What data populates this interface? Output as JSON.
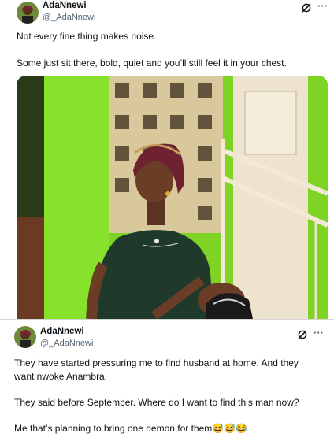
{
  "tweets": [
    {
      "author": {
        "name": "AdaNnewi",
        "handle": "@_AdaNnewi"
      },
      "text": [
        "Not every fine thing makes noise.",
        "Some just sit there, bold, quiet and you’ll still feel it in your chest."
      ],
      "icons": [
        "grok-icon",
        "more-icon"
      ]
    },
    {
      "author": {
        "name": "AdaNnewi",
        "handle": "@_AdaNnewi"
      },
      "text": [
        "They have started pressuring me to find husband at home. And they",
        "want nwoke Anambra.",
        "They said before September.  Where do I want to find this man now?",
        "Me that’s planning to bring one demon for them😅😅😂"
      ],
      "icons": [
        "grok-icon",
        "more-icon"
      ]
    }
  ],
  "more_glyph": "···"
}
